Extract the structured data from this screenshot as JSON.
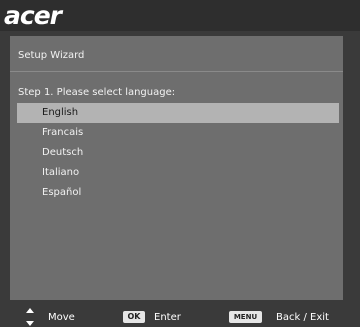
{
  "brand": {
    "logo_text": "acer"
  },
  "panel": {
    "title": "Setup Wizard",
    "step_label": "Step 1. Please select language:",
    "languages": [
      {
        "label": "English",
        "selected": true
      },
      {
        "label": "Francais",
        "selected": false
      },
      {
        "label": "Deutsch",
        "selected": false
      },
      {
        "label": "Italiano",
        "selected": false
      },
      {
        "label": "Español",
        "selected": false
      }
    ]
  },
  "footer": {
    "move_icon": "up-down-arrows-icon",
    "move_label": "Move",
    "ok_badge": "OK",
    "enter_label": "Enter",
    "menu_badge": "MENU",
    "back_exit_label": "Back / Exit"
  },
  "colors": {
    "background": "#3a3a3a",
    "panel": "#6e6e6e",
    "selected_row": "#b3b3b3"
  }
}
